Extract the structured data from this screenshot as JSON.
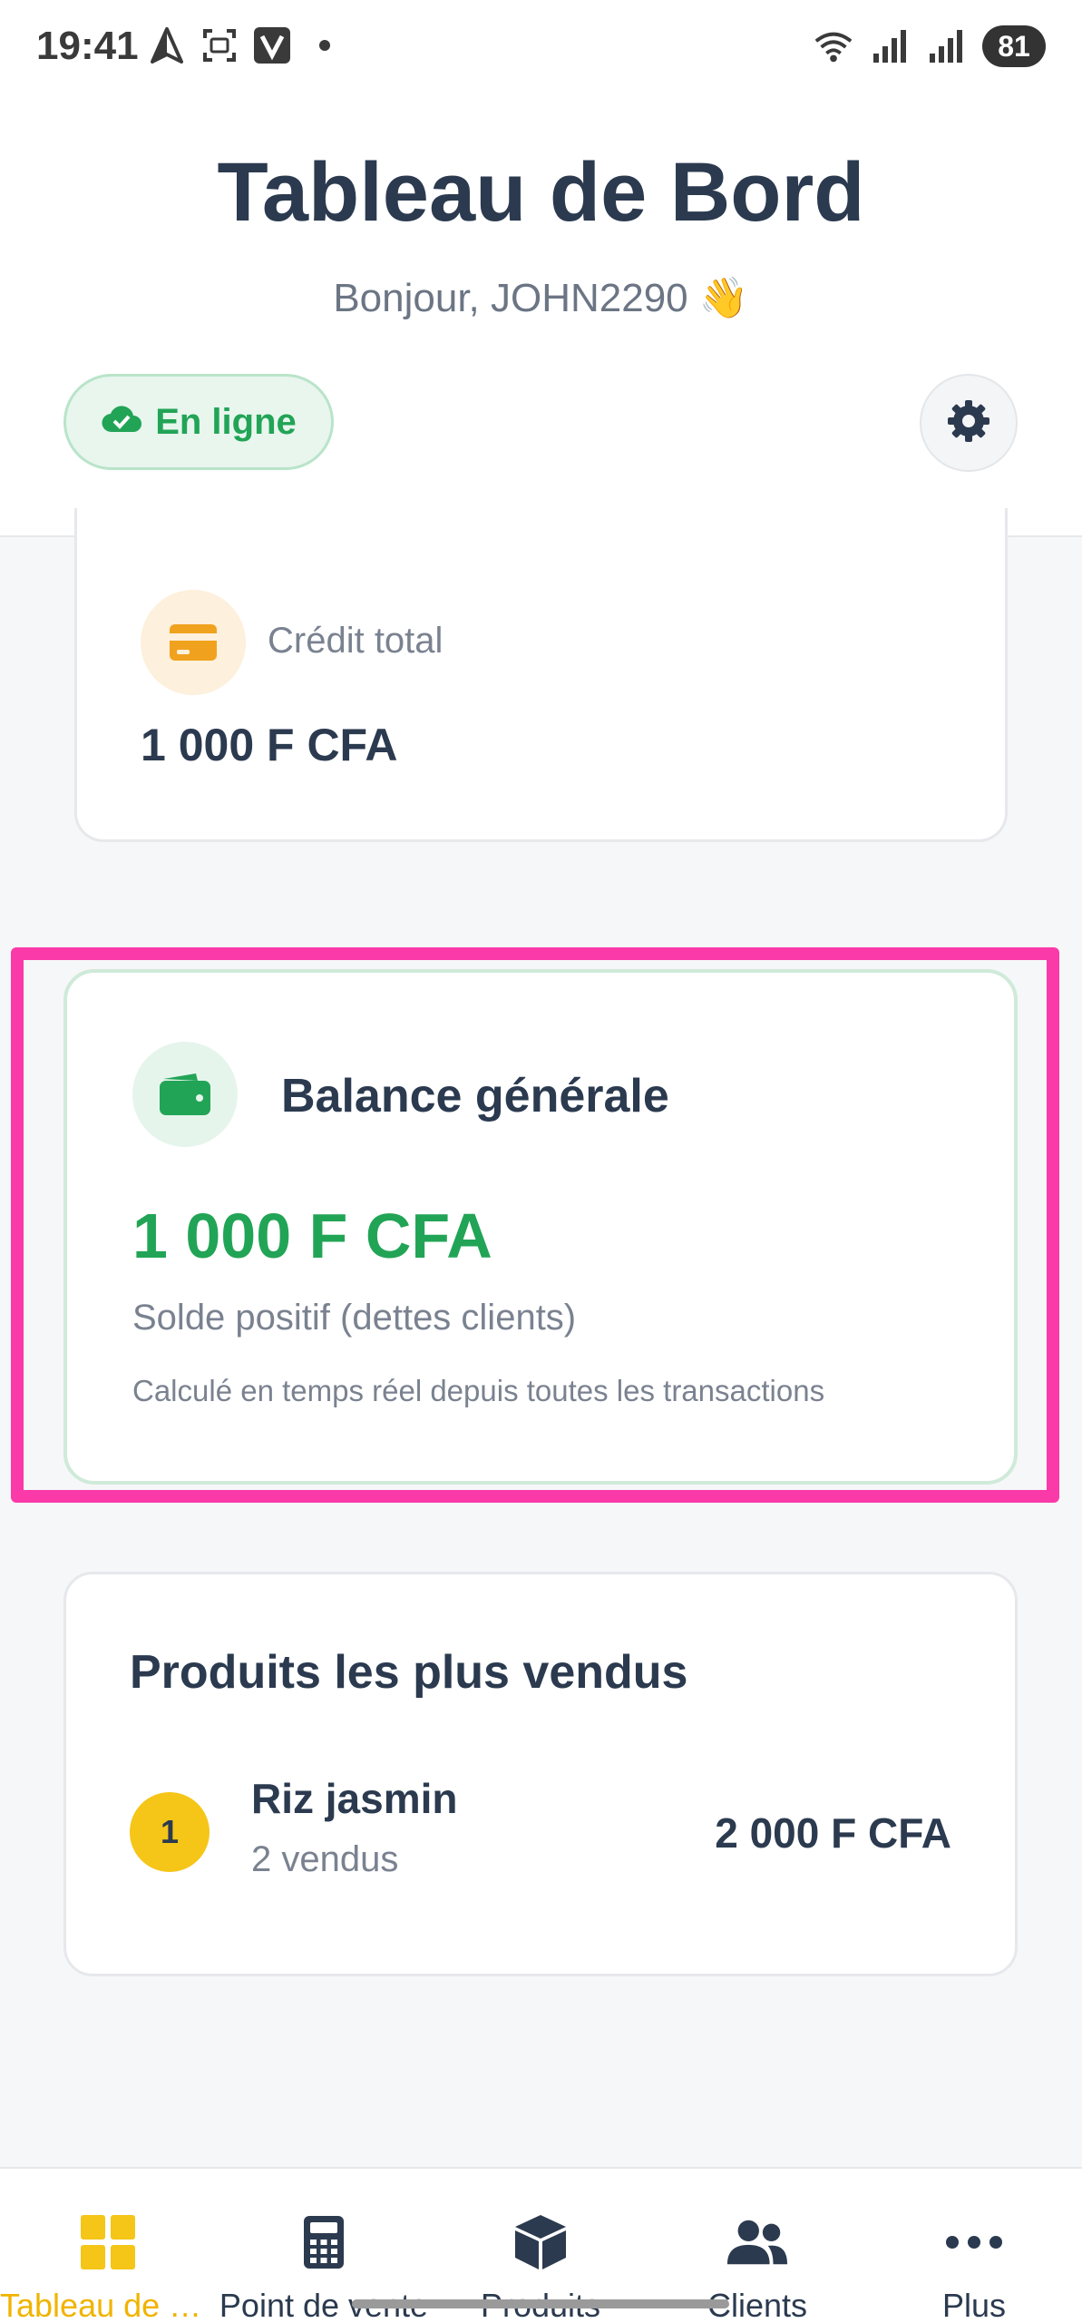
{
  "status_bar": {
    "time": "19:41",
    "battery": "81",
    "left_icons": [
      "navigation-icon",
      "screen-capture-icon",
      "v-app-icon",
      "dot-icon"
    ],
    "right_icons": [
      "wifi-icon",
      "signal-icon",
      "signal-icon"
    ]
  },
  "header": {
    "title": "Tableau de Bord",
    "greeting": "Bonjour, JOHN2290 👋",
    "status_badge": "En ligne",
    "colors": {
      "online": "#22a456",
      "accent": "#f0b400"
    }
  },
  "credit_card": {
    "label": "Crédit total",
    "value": "1 000 F CFA"
  },
  "balance_card": {
    "title": "Balance générale",
    "value": "1 000 F CFA",
    "subtitle": "Solde positif (dettes clients)",
    "note": "Calculé en temps réel depuis toutes les transactions",
    "highlight_color": "#fa3aa8"
  },
  "top_products": {
    "title": "Produits les plus vendus",
    "items": [
      {
        "rank": "1",
        "name": "Riz jasmin",
        "sold": "2 vendus",
        "amount": "2 000 F CFA"
      }
    ]
  },
  "bottom_nav": {
    "items": [
      {
        "label": "Tableau de Bord",
        "icon": "grid-icon",
        "active": true
      },
      {
        "label": "Point de vente",
        "icon": "calculator-icon",
        "active": false
      },
      {
        "label": "Produits",
        "icon": "box-icon",
        "active": false
      },
      {
        "label": "Clients",
        "icon": "users-icon",
        "active": false
      },
      {
        "label": "Plus",
        "icon": "more-icon",
        "active": false
      }
    ]
  }
}
